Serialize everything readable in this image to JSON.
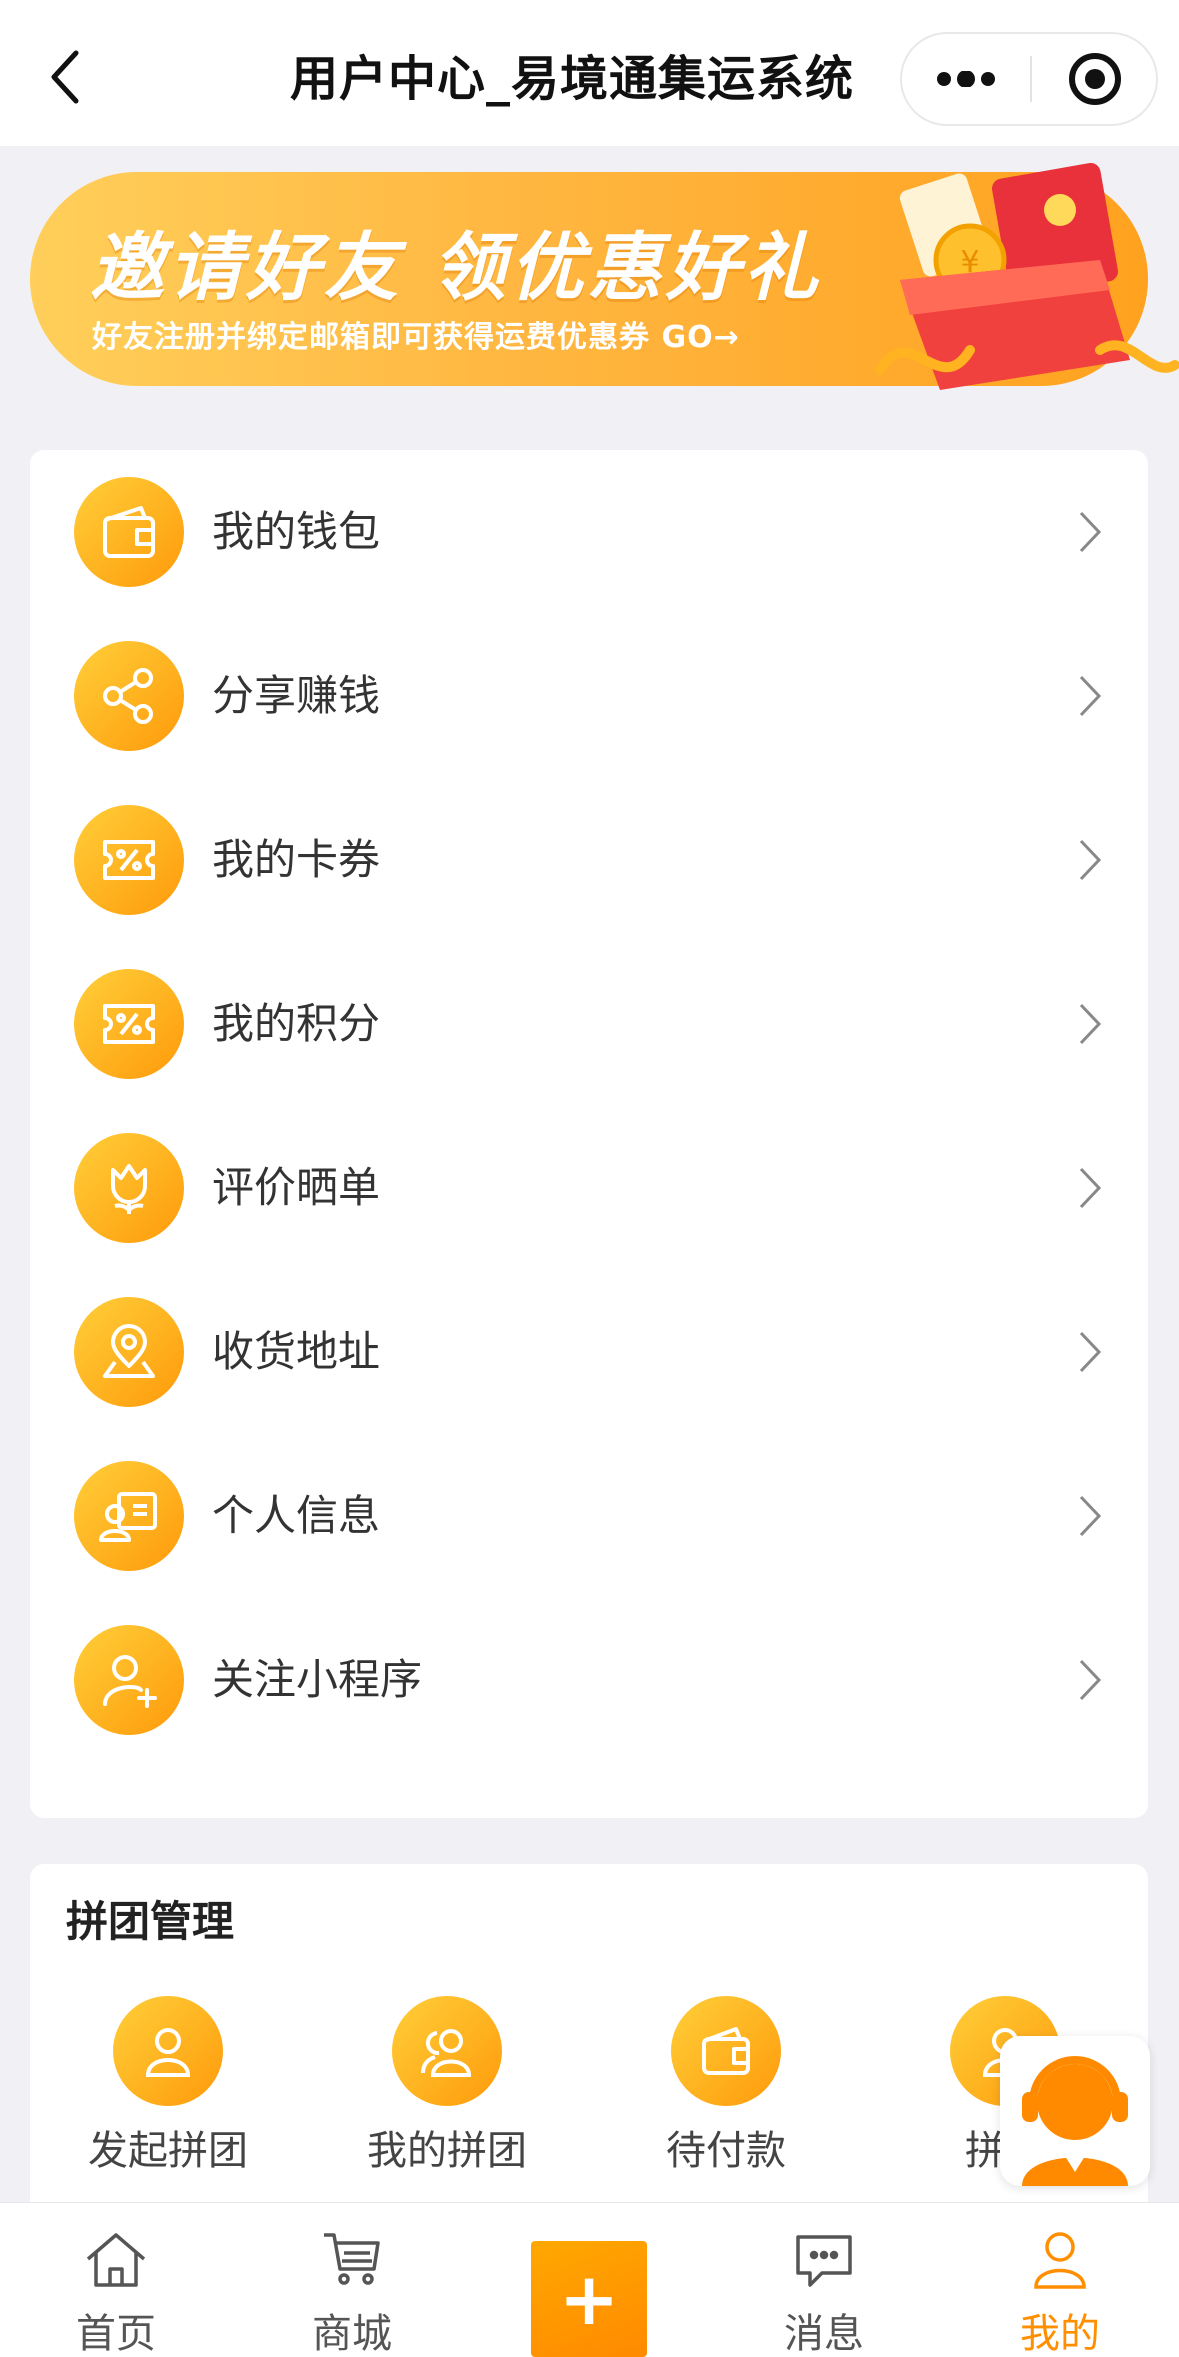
{
  "header": {
    "title": "用户中心_易境通集运系统"
  },
  "banner": {
    "title": "邀请好友 领优惠好礼",
    "subtitle": "好友注册并绑定邮箱即可获得运费优惠券 GO→"
  },
  "menu": {
    "items": [
      {
        "label": "我的钱包",
        "icon": "wallet-icon"
      },
      {
        "label": "分享赚钱",
        "icon": "share-icon"
      },
      {
        "label": "我的卡券",
        "icon": "coupon-icon"
      },
      {
        "label": "我的积分",
        "icon": "points-icon"
      },
      {
        "label": "评价晒单",
        "icon": "tulip-icon"
      },
      {
        "label": "收货地址",
        "icon": "location-pin-icon"
      },
      {
        "label": "个人信息",
        "icon": "profile-card-icon"
      },
      {
        "label": "关注小程序",
        "icon": "user-add-icon"
      }
    ]
  },
  "group": {
    "title": "拼团管理",
    "items": [
      {
        "label": "发起拼团",
        "icon": "user-icon"
      },
      {
        "label": "我的拼团",
        "icon": "users-icon"
      },
      {
        "label": "待付款",
        "icon": "wallet-icon"
      },
      {
        "label": "拼团",
        "icon": "user-icon"
      }
    ]
  },
  "tabbar": {
    "items": [
      {
        "label": "首页",
        "icon": "home-icon"
      },
      {
        "label": "商城",
        "icon": "cart-icon"
      },
      {
        "label": "+",
        "icon": "plus-icon"
      },
      {
        "label": "消息",
        "icon": "message-icon"
      },
      {
        "label": "我的",
        "icon": "user-icon",
        "active": true
      }
    ]
  },
  "colors": {
    "accent": "#ff9a0a",
    "accent_light": "#ffcf3a",
    "active_tab": "#ff8f00",
    "background": "#f1f1f5"
  }
}
